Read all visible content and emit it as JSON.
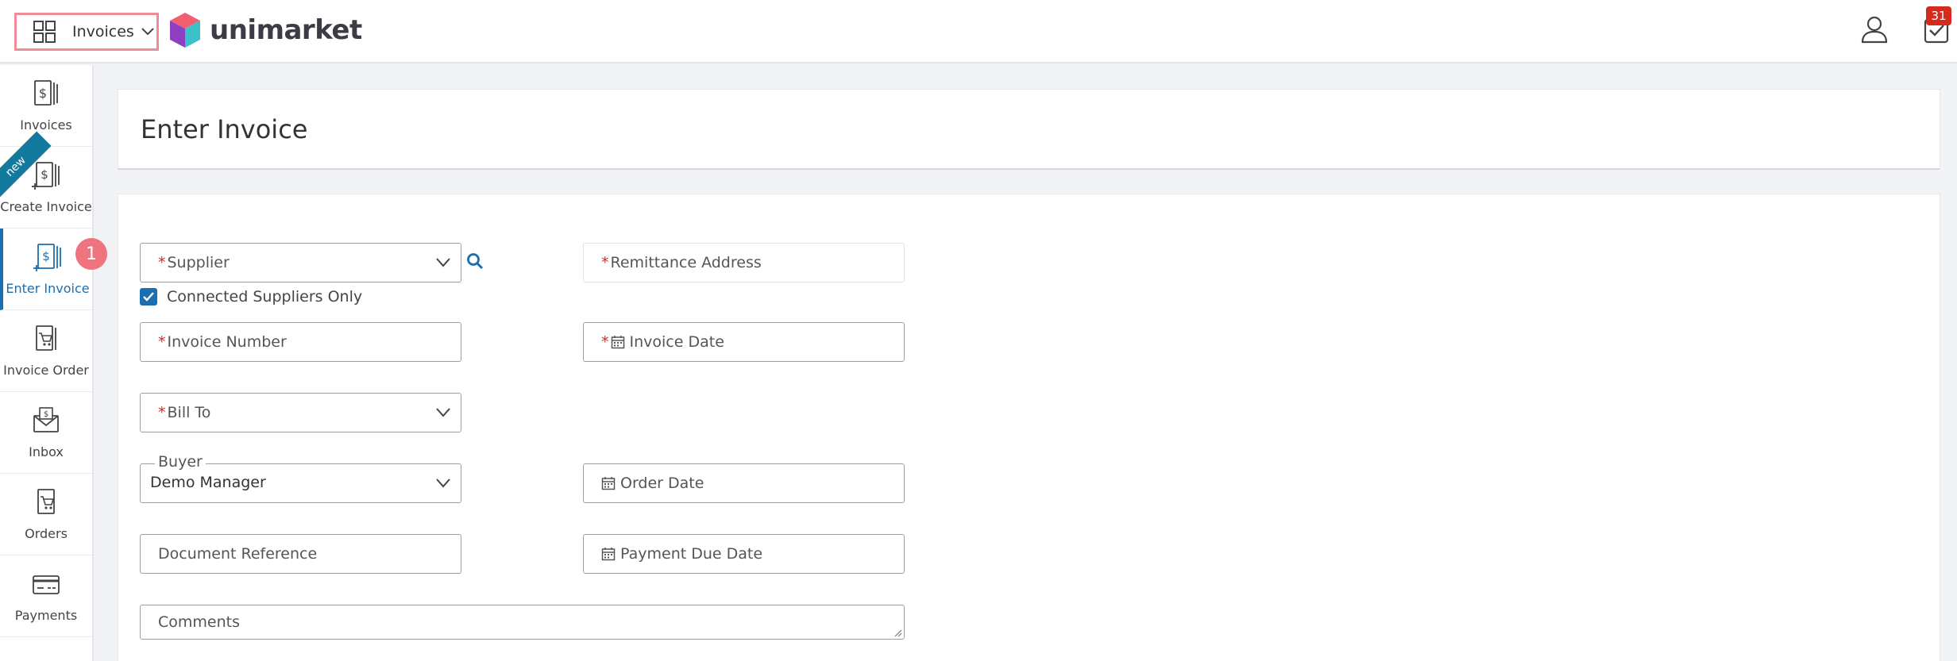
{
  "topbar": {
    "app_switcher_label": "Invoices",
    "logo_text": "unimarket",
    "tasks_badge_count": "31"
  },
  "sidebar": {
    "items": [
      {
        "label": "Invoices",
        "icon": "invoice-icon"
      },
      {
        "label": "Create Invoice",
        "icon": "create-invoice-icon",
        "ribbon": "new"
      },
      {
        "label": "Enter Invoice",
        "icon": "enter-invoice-icon",
        "active": true
      },
      {
        "label": "Invoice Order",
        "icon": "invoice-order-icon"
      },
      {
        "label": "Inbox",
        "icon": "inbox-icon"
      },
      {
        "label": "Orders",
        "icon": "orders-icon"
      },
      {
        "label": "Payments",
        "icon": "payments-icon"
      }
    ]
  },
  "step_badge": "1",
  "page": {
    "title": "Enter Invoice"
  },
  "form": {
    "supplier_placeholder": "Supplier",
    "remittance_placeholder": "Remittance Address",
    "connected_suppliers_label": "Connected Suppliers Only",
    "connected_suppliers_checked": true,
    "invoice_number_placeholder": "Invoice Number",
    "invoice_date_placeholder": "Invoice Date",
    "bill_to_placeholder": "Bill To",
    "buyer_label": "Buyer",
    "buyer_value": "Demo Manager",
    "order_date_placeholder": "Order Date",
    "document_reference_placeholder": "Document Reference",
    "payment_due_date_placeholder": "Payment Due Date",
    "comments_placeholder": "Comments",
    "required_mark": "*"
  },
  "colors": {
    "accent": "#1a6fb0",
    "required": "#d52b1e",
    "highlight": "#ec8d97",
    "step_badge": "#f07380",
    "ribbon": "#137a9e"
  }
}
